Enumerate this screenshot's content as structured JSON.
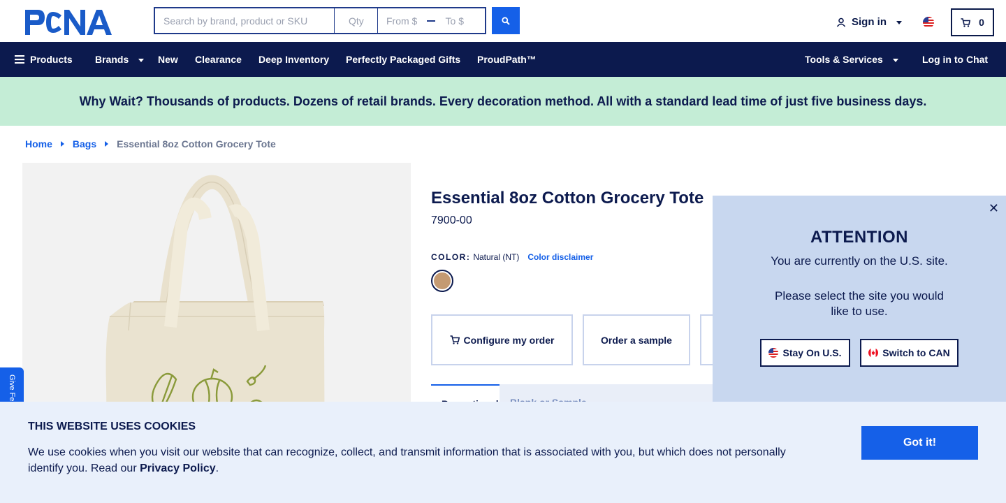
{
  "header": {
    "logo_text": "PCNA",
    "search": {
      "placeholder": "Search by brand, product or SKU",
      "qty_placeholder": "Qty",
      "from_placeholder": "From $",
      "to_placeholder": "To $",
      "button_icon": "search-icon"
    },
    "sign_in_label": "Sign in",
    "cart_count": "0",
    "region_flag": "us-flag-icon"
  },
  "nav": {
    "items": [
      {
        "label": "Products"
      },
      {
        "label": "Brands"
      },
      {
        "label": "New"
      },
      {
        "label": "Clearance"
      },
      {
        "label": "Deep Inventory"
      },
      {
        "label": "Perfectly Packaged Gifts"
      },
      {
        "label": "ProudPath™"
      }
    ],
    "tools_label": "Tools & Services",
    "chat_label": "Log in to Chat"
  },
  "banner": {
    "text": "Why Wait? Thousands of products. Dozens of retail brands. Every decoration method. All with a standard lead time of just five business days."
  },
  "breadcrumb": {
    "home": "Home",
    "category": "Bags",
    "current": "Essential 8oz Cotton Grocery Tote"
  },
  "product": {
    "title": "Essential 8oz Cotton Grocery Tote",
    "sku": "7900-00",
    "color_label": "COLOR:",
    "color_value": "Natural (NT)",
    "color_disclaimer": "Color disclaimer",
    "swatch_color": "#c49a72",
    "actions": {
      "configure": "Configure my order",
      "sample": "Order a sample"
    },
    "tabs": {
      "first": "Promotional",
      "second": "Blank or Sample"
    }
  },
  "feedback": {
    "label": "Give Feedback"
  },
  "attention_modal": {
    "title": "ATTENTION",
    "line1": "You are currently on the U.S. site.",
    "line2": "Please select the site you would like to use.",
    "stay_label": "Stay On U.S.",
    "switch_label": "Switch to CAN"
  },
  "cookies": {
    "title": "THIS WEBSITE USES COOKIES",
    "text": "We use cookies when you visit our website that can recognize, collect, and transmit information that is associated with you, but which does not personally identify you. Read our ",
    "link": "Privacy Policy",
    "end": ".",
    "button": "Got it!"
  },
  "colors": {
    "navy": "#0c1a4e",
    "accent_blue": "#1560e8",
    "banner_green": "#c4edd6",
    "modal_blue": "#c8d7ef",
    "cookie_bg": "#e9f0fb"
  }
}
